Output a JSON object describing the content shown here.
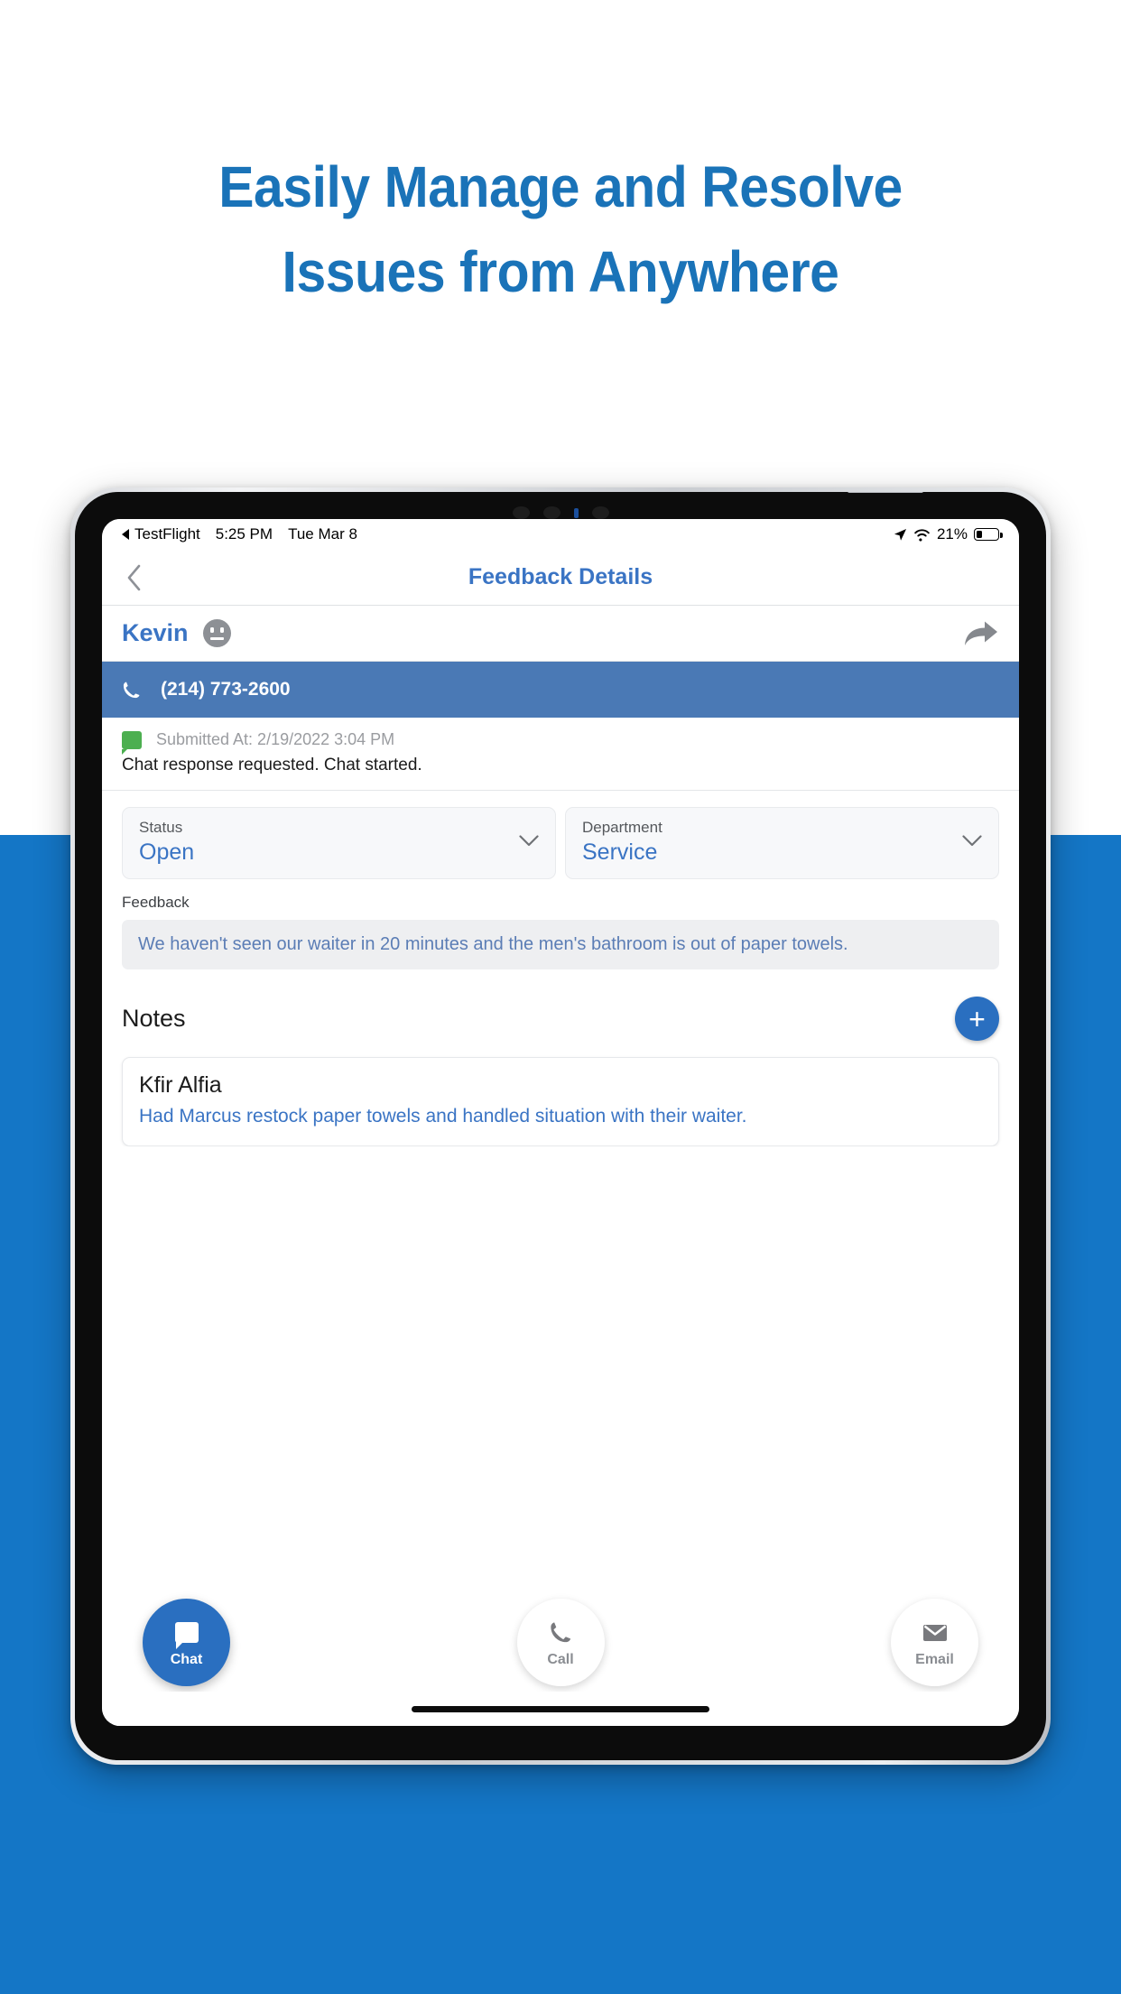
{
  "marketing": {
    "headline_line1": "Easily Manage and Resolve",
    "headline_line2": "Issues from Anywhere",
    "headline_color": "#1a73b8",
    "background_band_color": "#1476c6"
  },
  "status_bar": {
    "back_app": "TestFlight",
    "time": "5:25 PM",
    "date": "Tue Mar 8",
    "battery_percent": "21%",
    "icons": [
      "back-triangle-icon",
      "location-arrow-icon",
      "wifi-icon",
      "battery-icon"
    ]
  },
  "nav_bar": {
    "back_icon": "chevron-left-icon",
    "title": "Feedback Details"
  },
  "contact": {
    "name": "Kevin",
    "mood_icon": "neutral-face-icon",
    "share_icon": "share-arrow-icon",
    "phone_icon": "phone-icon",
    "phone_number": "(214) 773-2600"
  },
  "submission": {
    "channel_icon": "chat-bubble-icon",
    "submitted_at": "Submitted At: 2/19/2022 3:04 PM",
    "body": "Chat response requested. Chat started."
  },
  "fields": [
    {
      "label": "Status",
      "value": "Open",
      "chevron": "chevron-down-icon"
    },
    {
      "label": "Department",
      "value": "Service",
      "chevron": "chevron-down-icon"
    }
  ],
  "feedback": {
    "label": "Feedback",
    "text": "We haven't seen our waiter in 20 minutes and the men's bathroom is out of paper towels."
  },
  "notes": {
    "title": "Notes",
    "add_label": "+",
    "items": [
      {
        "author": "Kfir Alfia",
        "body": "Had Marcus restock paper towels and handled situation with their waiter."
      }
    ]
  },
  "actions": [
    {
      "label": "Chat",
      "icon": "chat-bubble-icon",
      "primary": true
    },
    {
      "label": "Call",
      "icon": "phone-icon",
      "primary": false
    },
    {
      "label": "Email",
      "icon": "envelope-icon",
      "primary": false
    }
  ],
  "colors": {
    "accent_blue": "#2a6fc0",
    "link_blue": "#3a74c4",
    "phone_bar_blue": "#4a79b5",
    "green": "#4caf50",
    "muted_gray": "#8a8d92"
  }
}
